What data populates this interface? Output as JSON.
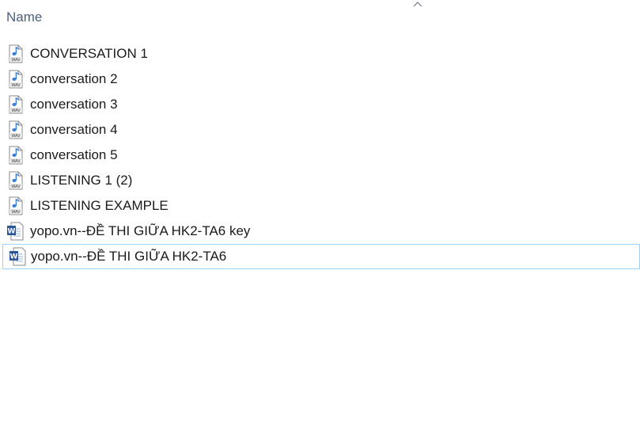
{
  "header": {
    "name_column": "Name",
    "sort_icon": "chevron-up-icon"
  },
  "files": [
    {
      "name": "CONVERSATION 1",
      "icon": "wav-audio-icon"
    },
    {
      "name": "conversation 2",
      "icon": "wav-audio-icon"
    },
    {
      "name": "conversation 3",
      "icon": "wav-audio-icon"
    },
    {
      "name": "conversation 4",
      "icon": "wav-audio-icon"
    },
    {
      "name": "conversation 5",
      "icon": "wav-audio-icon"
    },
    {
      "name": "LISTENING 1 (2)",
      "icon": "wav-audio-icon"
    },
    {
      "name": "LISTENING EXAMPLE",
      "icon": "wav-audio-icon"
    },
    {
      "name": "yopo.vn--ĐỀ THI GIỮA HK2-TA6 key",
      "icon": "word-document-icon"
    },
    {
      "name": "yopo.vn--ĐỀ THI GIỮA HK2-TA6",
      "icon": "word-document-icon",
      "selected": true
    }
  ],
  "colors": {
    "header_text": "#4c607a",
    "selection_border": "#99d1ff",
    "word_blue": "#2b579a",
    "audio_blue": "#3a7bd5"
  }
}
